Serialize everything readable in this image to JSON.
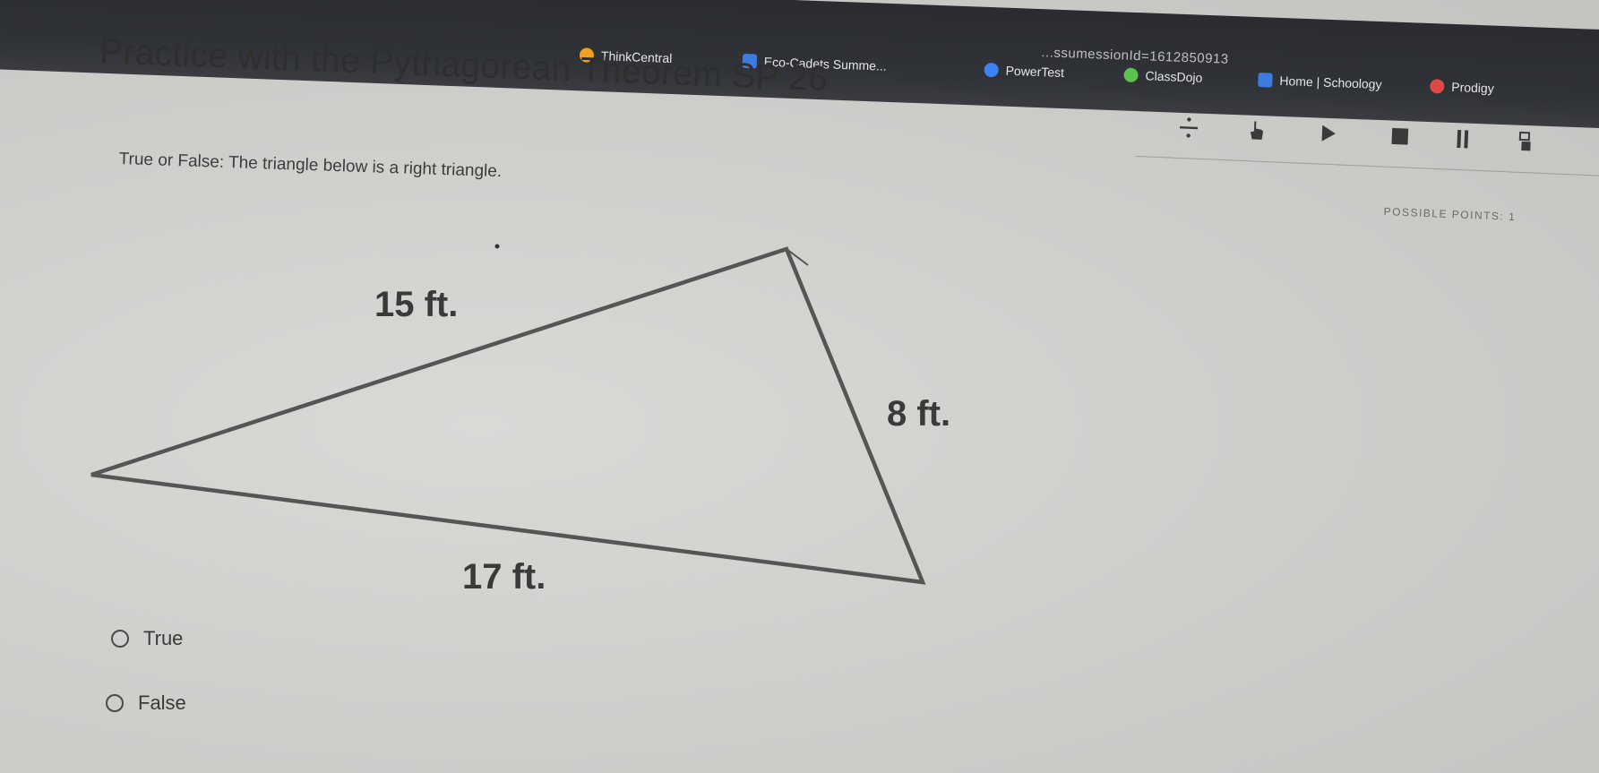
{
  "browser": {
    "url_fragment": "...ssumessionId=1612850913",
    "bookmarks": [
      {
        "label": "ThinkCentral",
        "icon": "circle-orange-icon",
        "color": "#f0a020"
      },
      {
        "label": "Eco-Cadets Summe...",
        "icon": "flag-blue-icon",
        "color": "#3d7be0"
      },
      {
        "label": "PowerTest",
        "icon": "globe-blue-icon",
        "color": "#3b82f6"
      },
      {
        "label": "ClassDojo",
        "icon": "dojo-green-icon",
        "color": "#5cc14f"
      },
      {
        "label": "Home | Schoology",
        "icon": "flag-blue-icon",
        "color": "#3d7be0"
      },
      {
        "label": "Prodigy",
        "icon": "prodigy-red-icon",
        "color": "#e04848"
      }
    ]
  },
  "page": {
    "title": "Practice with the Pythagorean Theorem SP 26"
  },
  "toolbar": {
    "tools": [
      {
        "name": "fraction-calculator-icon"
      },
      {
        "name": "hand-pointer-icon"
      },
      {
        "name": "play-icon"
      },
      {
        "name": "stop-icon"
      },
      {
        "name": "pause-icon"
      },
      {
        "name": "highlighter-icon"
      }
    ],
    "points_label": "POSSIBLE POINTS: 1"
  },
  "question": {
    "prompt": "True or False: The triangle below is a right triangle.",
    "figure": {
      "side_labels": [
        "15 ft.",
        "8 ft.",
        "17 ft."
      ]
    },
    "options": [
      {
        "label": "True"
      },
      {
        "label": "False"
      }
    ]
  }
}
